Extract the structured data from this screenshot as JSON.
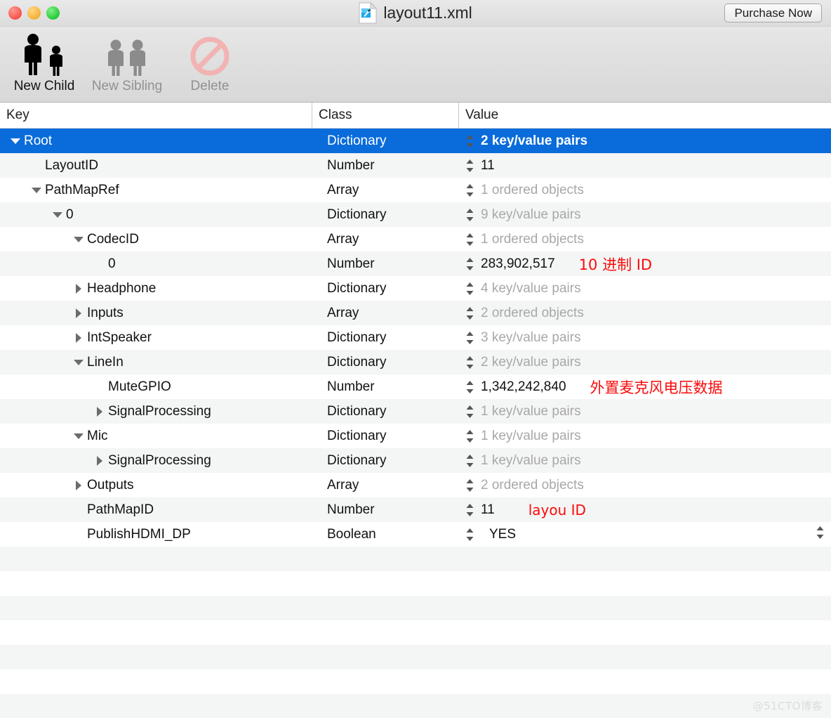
{
  "window": {
    "title": "layout11.xml",
    "doc_icon": "xml-document-icon",
    "purchase_label": "Purchase Now",
    "traffic_lights": [
      "close-button",
      "minimize-button",
      "zoom-button"
    ]
  },
  "toolbar": {
    "items": [
      {
        "label": "New Child",
        "icon": "two-people-icon",
        "enabled": true
      },
      {
        "label": "New Sibling",
        "icon": "two-people-icon",
        "enabled": false
      },
      {
        "label": "Delete",
        "icon": "no-entry-icon",
        "enabled": false
      }
    ]
  },
  "table": {
    "columns": [
      "Key",
      "Class",
      "Value"
    ],
    "rows": [
      {
        "key": "Root",
        "indent": 0,
        "twisty": "open",
        "class": "Dictionary",
        "value": "2 key/value pairs",
        "dim": false,
        "selected": true,
        "annotation": ""
      },
      {
        "key": "LayoutID",
        "indent": 1,
        "twisty": "none",
        "class": "Number",
        "value": "11",
        "dim": false,
        "selected": false,
        "annotation": ""
      },
      {
        "key": "PathMapRef",
        "indent": 1,
        "twisty": "open",
        "class": "Array",
        "value": "1 ordered objects",
        "dim": true,
        "selected": false,
        "annotation": ""
      },
      {
        "key": "0",
        "indent": 2,
        "twisty": "open",
        "class": "Dictionary",
        "value": "9 key/value pairs",
        "dim": true,
        "selected": false,
        "annotation": ""
      },
      {
        "key": "CodecID",
        "indent": 3,
        "twisty": "open",
        "class": "Array",
        "value": "1 ordered objects",
        "dim": true,
        "selected": false,
        "annotation": ""
      },
      {
        "key": "0",
        "indent": 4,
        "twisty": "none",
        "class": "Number",
        "value": "283,902,517",
        "dim": false,
        "selected": false,
        "annotation": "10 进制 ID"
      },
      {
        "key": "Headphone",
        "indent": 3,
        "twisty": "closed",
        "class": "Dictionary",
        "value": "4 key/value pairs",
        "dim": true,
        "selected": false,
        "annotation": ""
      },
      {
        "key": "Inputs",
        "indent": 3,
        "twisty": "closed",
        "class": "Array",
        "value": "2 ordered objects",
        "dim": true,
        "selected": false,
        "annotation": ""
      },
      {
        "key": "IntSpeaker",
        "indent": 3,
        "twisty": "closed",
        "class": "Dictionary",
        "value": "3 key/value pairs",
        "dim": true,
        "selected": false,
        "annotation": ""
      },
      {
        "key": "LineIn",
        "indent": 3,
        "twisty": "open",
        "class": "Dictionary",
        "value": "2 key/value pairs",
        "dim": true,
        "selected": false,
        "annotation": ""
      },
      {
        "key": "MuteGPIO",
        "indent": 4,
        "twisty": "none",
        "class": "Number",
        "value": "1,342,242,840",
        "dim": false,
        "selected": false,
        "annotation": "外置麦克风电压数据"
      },
      {
        "key": "SignalProcessing",
        "indent": 4,
        "twisty": "closed",
        "class": "Dictionary",
        "value": "1 key/value pairs",
        "dim": true,
        "selected": false,
        "annotation": ""
      },
      {
        "key": "Mic",
        "indent": 3,
        "twisty": "open",
        "class": "Dictionary",
        "value": "1 key/value pairs",
        "dim": true,
        "selected": false,
        "annotation": ""
      },
      {
        "key": "SignalProcessing",
        "indent": 4,
        "twisty": "closed",
        "class": "Dictionary",
        "value": "1 key/value pairs",
        "dim": true,
        "selected": false,
        "annotation": ""
      },
      {
        "key": "Outputs",
        "indent": 3,
        "twisty": "closed",
        "class": "Array",
        "value": "2 ordered objects",
        "dim": true,
        "selected": false,
        "annotation": ""
      },
      {
        "key": "PathMapID",
        "indent": 3,
        "twisty": "none",
        "class": "Number",
        "value": "11",
        "dim": false,
        "selected": false,
        "annotation": "layou  ID"
      },
      {
        "key": "PublishHDMI_DP",
        "indent": 3,
        "twisty": "none",
        "class": "Boolean",
        "value": "YES",
        "dim": false,
        "selected": false,
        "annotation": "",
        "bool_stepper": true
      }
    ],
    "empty_row_count": 7
  },
  "watermark": "@51CTO博客",
  "colors": {
    "selection": "#0a6cdb",
    "annotation": "#fb0b0b",
    "row_alt": "#f4f5f5",
    "dim_text": "#a8a8a8"
  }
}
